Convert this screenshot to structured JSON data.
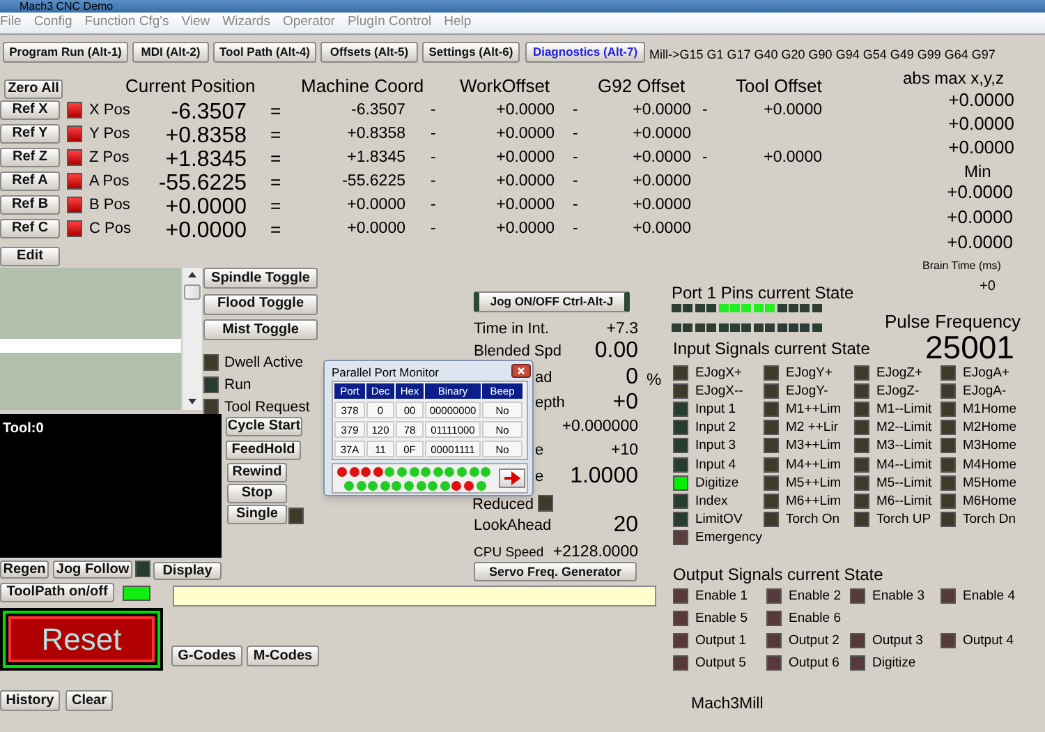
{
  "window": {
    "title": "Mach3 CNC  Demo"
  },
  "menu": [
    "File",
    "Config",
    "Function Cfg's",
    "View",
    "Wizards",
    "Operator",
    "PlugIn Control",
    "Help"
  ],
  "tabs": [
    {
      "label": "Program Run (Alt-1)",
      "selected": false
    },
    {
      "label": "MDI (Alt-2)",
      "selected": false
    },
    {
      "label": "Tool Path (Alt-4)",
      "selected": false
    },
    {
      "label": "Offsets (Alt-5)",
      "selected": false
    },
    {
      "label": "Settings (Alt-6)",
      "selected": false
    },
    {
      "label": "Diagnostics (Alt-7)",
      "selected": true
    }
  ],
  "modal_codes": "Mill->G15  G1 G17 G40 G20 G90 G94 G54 G49 G99 G64 G97",
  "dro": {
    "zero_all": "Zero All",
    "columns": [
      "Current Position",
      "Machine Coord",
      "WorkOffset",
      "G92 Offset",
      "Tool Offset"
    ],
    "rows": [
      {
        "ref": "Ref X",
        "label": "X Pos",
        "current": "-6.3507",
        "equals": "=",
        "machine": "-6.3507",
        "minus_1": "-",
        "work": "+0.0000",
        "minus_2": "-",
        "g92": "+0.0000",
        "minus_3": "-",
        "tool": "+0.0000"
      },
      {
        "ref": "Ref Y",
        "label": "Y Pos",
        "current": "+0.8358",
        "equals": "=",
        "machine": "+0.8358",
        "minus_1": "-",
        "work": "+0.0000",
        "minus_2": "-",
        "g92": "+0.0000"
      },
      {
        "ref": "Ref Z",
        "label": "Z Pos",
        "current": "+1.8345",
        "equals": "=",
        "machine": "+1.8345",
        "minus_1": "-",
        "work": "+0.0000",
        "minus_2": "-",
        "g92": "+0.0000",
        "minus_3": "-",
        "tool": "+0.0000"
      },
      {
        "ref": "Ref A",
        "label": "A Pos",
        "current": "-55.6225",
        "equals": "=",
        "machine": "-55.6225",
        "minus_1": "-",
        "work": "+0.0000",
        "minus_2": "-",
        "g92": "+0.0000"
      },
      {
        "ref": "Ref B",
        "label": "B Pos",
        "current": "+0.0000",
        "equals": "=",
        "machine": "+0.0000",
        "minus_1": "-",
        "work": "+0.0000",
        "minus_2": "-",
        "g92": "+0.0000"
      },
      {
        "ref": "Ref C",
        "label": "C Pos",
        "current": "+0.0000",
        "equals": "=",
        "machine": "+0.0000",
        "minus_1": "-",
        "work": "+0.0000",
        "minus_2": "-",
        "g92": "+0.0000"
      }
    ]
  },
  "edit_button": "Edit",
  "abs_max": {
    "title": "abs max x,y,z",
    "max": [
      "+0.0000",
      "+0.0000",
      "+0.0000"
    ],
    "min_label": "Min",
    "min": [
      "+0.0000",
      "+0.0000",
      "+0.0000"
    ],
    "brain_time_label": "Brain Time (ms)",
    "brain_time": "+0"
  },
  "spindle_buttons": [
    "Spindle Toggle",
    "Flood Toggle",
    "Mist Toggle"
  ],
  "status_leds": [
    {
      "label": "Dwell Active",
      "color": "#3c3a28"
    },
    {
      "label": "Run",
      "color": "#263c2e"
    },
    {
      "label": "Tool Request",
      "color": "#3c3a28"
    }
  ],
  "tool_display": "Tool:0",
  "run_buttons": [
    "Cycle Start",
    "FeedHold",
    "Rewind",
    "Stop",
    "Single"
  ],
  "jog_button": "Jog ON/OFF Ctrl-Alt-J",
  "stats": [
    {
      "kind": "reading",
      "label": "Time in Int.",
      "value": "+7.3"
    },
    {
      "kind": "gauge",
      "label": "Blended Spd",
      "value": "0.00"
    },
    {
      "kind": "gauge",
      "covered": true,
      "label": "ad",
      "value": "0",
      "unit": "%"
    },
    {
      "kind": "gauge",
      "covered": true,
      "label": "epth",
      "value": "+0"
    },
    {
      "kind": "reading",
      "covered": true,
      "value": "+0.000000"
    },
    {
      "kind": "reading",
      "covered": true,
      "label": "e",
      "value": "+10"
    },
    {
      "kind": "gauge",
      "covered": true,
      "label": "e",
      "value": "1.0000"
    },
    {
      "kind": "indicator",
      "covered": true,
      "label": "Reduced"
    },
    {
      "kind": "gauge",
      "label": "LookAhead",
      "value": "20"
    },
    {
      "kind": "reading",
      "label": "CPU Speed",
      "value": "+2128.0000"
    }
  ],
  "servo_button": "Servo Freq. Generator",
  "port_monitor": {
    "title": "Parallel Port Monitor",
    "columns": [
      "Port",
      "Dec",
      "Hex",
      "Binary",
      "Beep"
    ],
    "rows": [
      [
        "378",
        "0",
        "00",
        "00000000",
        "No"
      ],
      [
        "379",
        "120",
        "78",
        "01111000",
        "No"
      ],
      [
        "37A",
        "11",
        "0F",
        "00001111",
        "No"
      ]
    ],
    "pins": [
      [
        true,
        true,
        true,
        true,
        false,
        false,
        false,
        false,
        false,
        false,
        false,
        false,
        false
      ],
      [
        false,
        false,
        false,
        false,
        false,
        false,
        false,
        false,
        false,
        true,
        true,
        false
      ]
    ]
  },
  "display_buttons": [
    "Regen",
    "Jog Follow",
    "Display"
  ],
  "toolpath": {
    "label": "ToolPath on/off",
    "on": true
  },
  "reset_button": "Reset",
  "code_buttons": [
    "G-Codes",
    "M-Codes"
  ],
  "history_buttons": [
    "History",
    "Clear"
  ],
  "port_pins": {
    "title": "Port 1 Pins current State",
    "rows": [
      [
        false,
        false,
        false,
        false,
        true,
        true,
        true,
        true,
        true,
        false,
        false,
        false,
        false
      ],
      [
        false,
        false,
        false,
        false,
        false,
        false,
        false,
        false,
        false,
        false,
        false,
        false,
        false
      ]
    ]
  },
  "pulse": {
    "label": "Pulse Frequency",
    "value": "25001"
  },
  "inputs": {
    "title": "Input Signals current State",
    "rows": [
      [
        {
          "label": "EJogX+",
          "color": "#3c3a28"
        },
        {
          "label": "EJogY+",
          "color": "#3c3a28"
        },
        {
          "label": "EJogZ+",
          "color": "#3c3a28"
        },
        {
          "label": "EJogA+",
          "color": "#3c3a28"
        }
      ],
      [
        {
          "label": "EJogX--",
          "color": "#3c3a28"
        },
        {
          "label": "EJogY-",
          "color": "#3c3a28"
        },
        {
          "label": "EJogZ-",
          "color": "#3c3a28"
        },
        {
          "label": "EJogA-",
          "color": "#3c3a28"
        }
      ],
      [
        {
          "label": "Input 1",
          "color": "#263c2e"
        },
        {
          "label": "M1++Lim",
          "color": "#3c3a28"
        },
        {
          "label": "M1--Limit",
          "color": "#3c3a28"
        },
        {
          "label": "M1Home",
          "color": "#3c3a28"
        }
      ],
      [
        {
          "label": "Input 2",
          "color": "#263c2e"
        },
        {
          "label": "M2 ++Lir",
          "color": "#3c3a28"
        },
        {
          "label": "M2--Limit",
          "color": "#3c3a28"
        },
        {
          "label": "M2Home",
          "color": "#3c3a28"
        }
      ],
      [
        {
          "label": "Input 3",
          "color": "#263c2e"
        },
        {
          "label": "M3++Lim",
          "color": "#3c3a28"
        },
        {
          "label": "M3--Limit",
          "color": "#3c3a28"
        },
        {
          "label": "M3Home",
          "color": "#3c3a28"
        }
      ],
      [
        {
          "label": "Input 4",
          "color": "#263c2e"
        },
        {
          "label": "M4++Lim",
          "color": "#3c3a28"
        },
        {
          "label": "M4--Limit",
          "color": "#3c3a28"
        },
        {
          "label": "M4Home",
          "color": "#3c3a28"
        }
      ],
      [
        {
          "label": "Digitize",
          "color": "#00ee00"
        },
        {
          "label": "M5++Lim",
          "color": "#3c3a28"
        },
        {
          "label": "M5--Limit",
          "color": "#3c3a28"
        },
        {
          "label": "M5Home",
          "color": "#3c3a28"
        }
      ],
      [
        {
          "label": "Index",
          "color": "#263c2e"
        },
        {
          "label": "M6++Lim",
          "color": "#3c3a28"
        },
        {
          "label": "M6--Limit",
          "color": "#3c3a28"
        },
        {
          "label": "M6Home",
          "color": "#3c3a28"
        }
      ],
      [
        {
          "label": "LimitOV",
          "color": "#263c2e"
        },
        {
          "label": "Torch On",
          "color": "#3c3a28"
        },
        {
          "label": "Torch UP",
          "color": "#3c3a28"
        },
        {
          "label": "Torch Dn",
          "color": "#3c3a28"
        }
      ],
      [
        {
          "label": "Emergency",
          "color": "#5a3e3e"
        }
      ]
    ]
  },
  "outputs": {
    "title": "Output Signals current State",
    "rows": [
      [
        "Enable 1",
        "Enable 2",
        "Enable 3",
        "Enable 4"
      ],
      [
        "Enable 5",
        "Enable 6"
      ],
      [
        "Output 1",
        "Output 2",
        "Output 3",
        "Output 4"
      ],
      [
        "Output 5",
        "Output 6",
        "Digitize"
      ]
    ]
  },
  "profile": "Mach3Mill"
}
